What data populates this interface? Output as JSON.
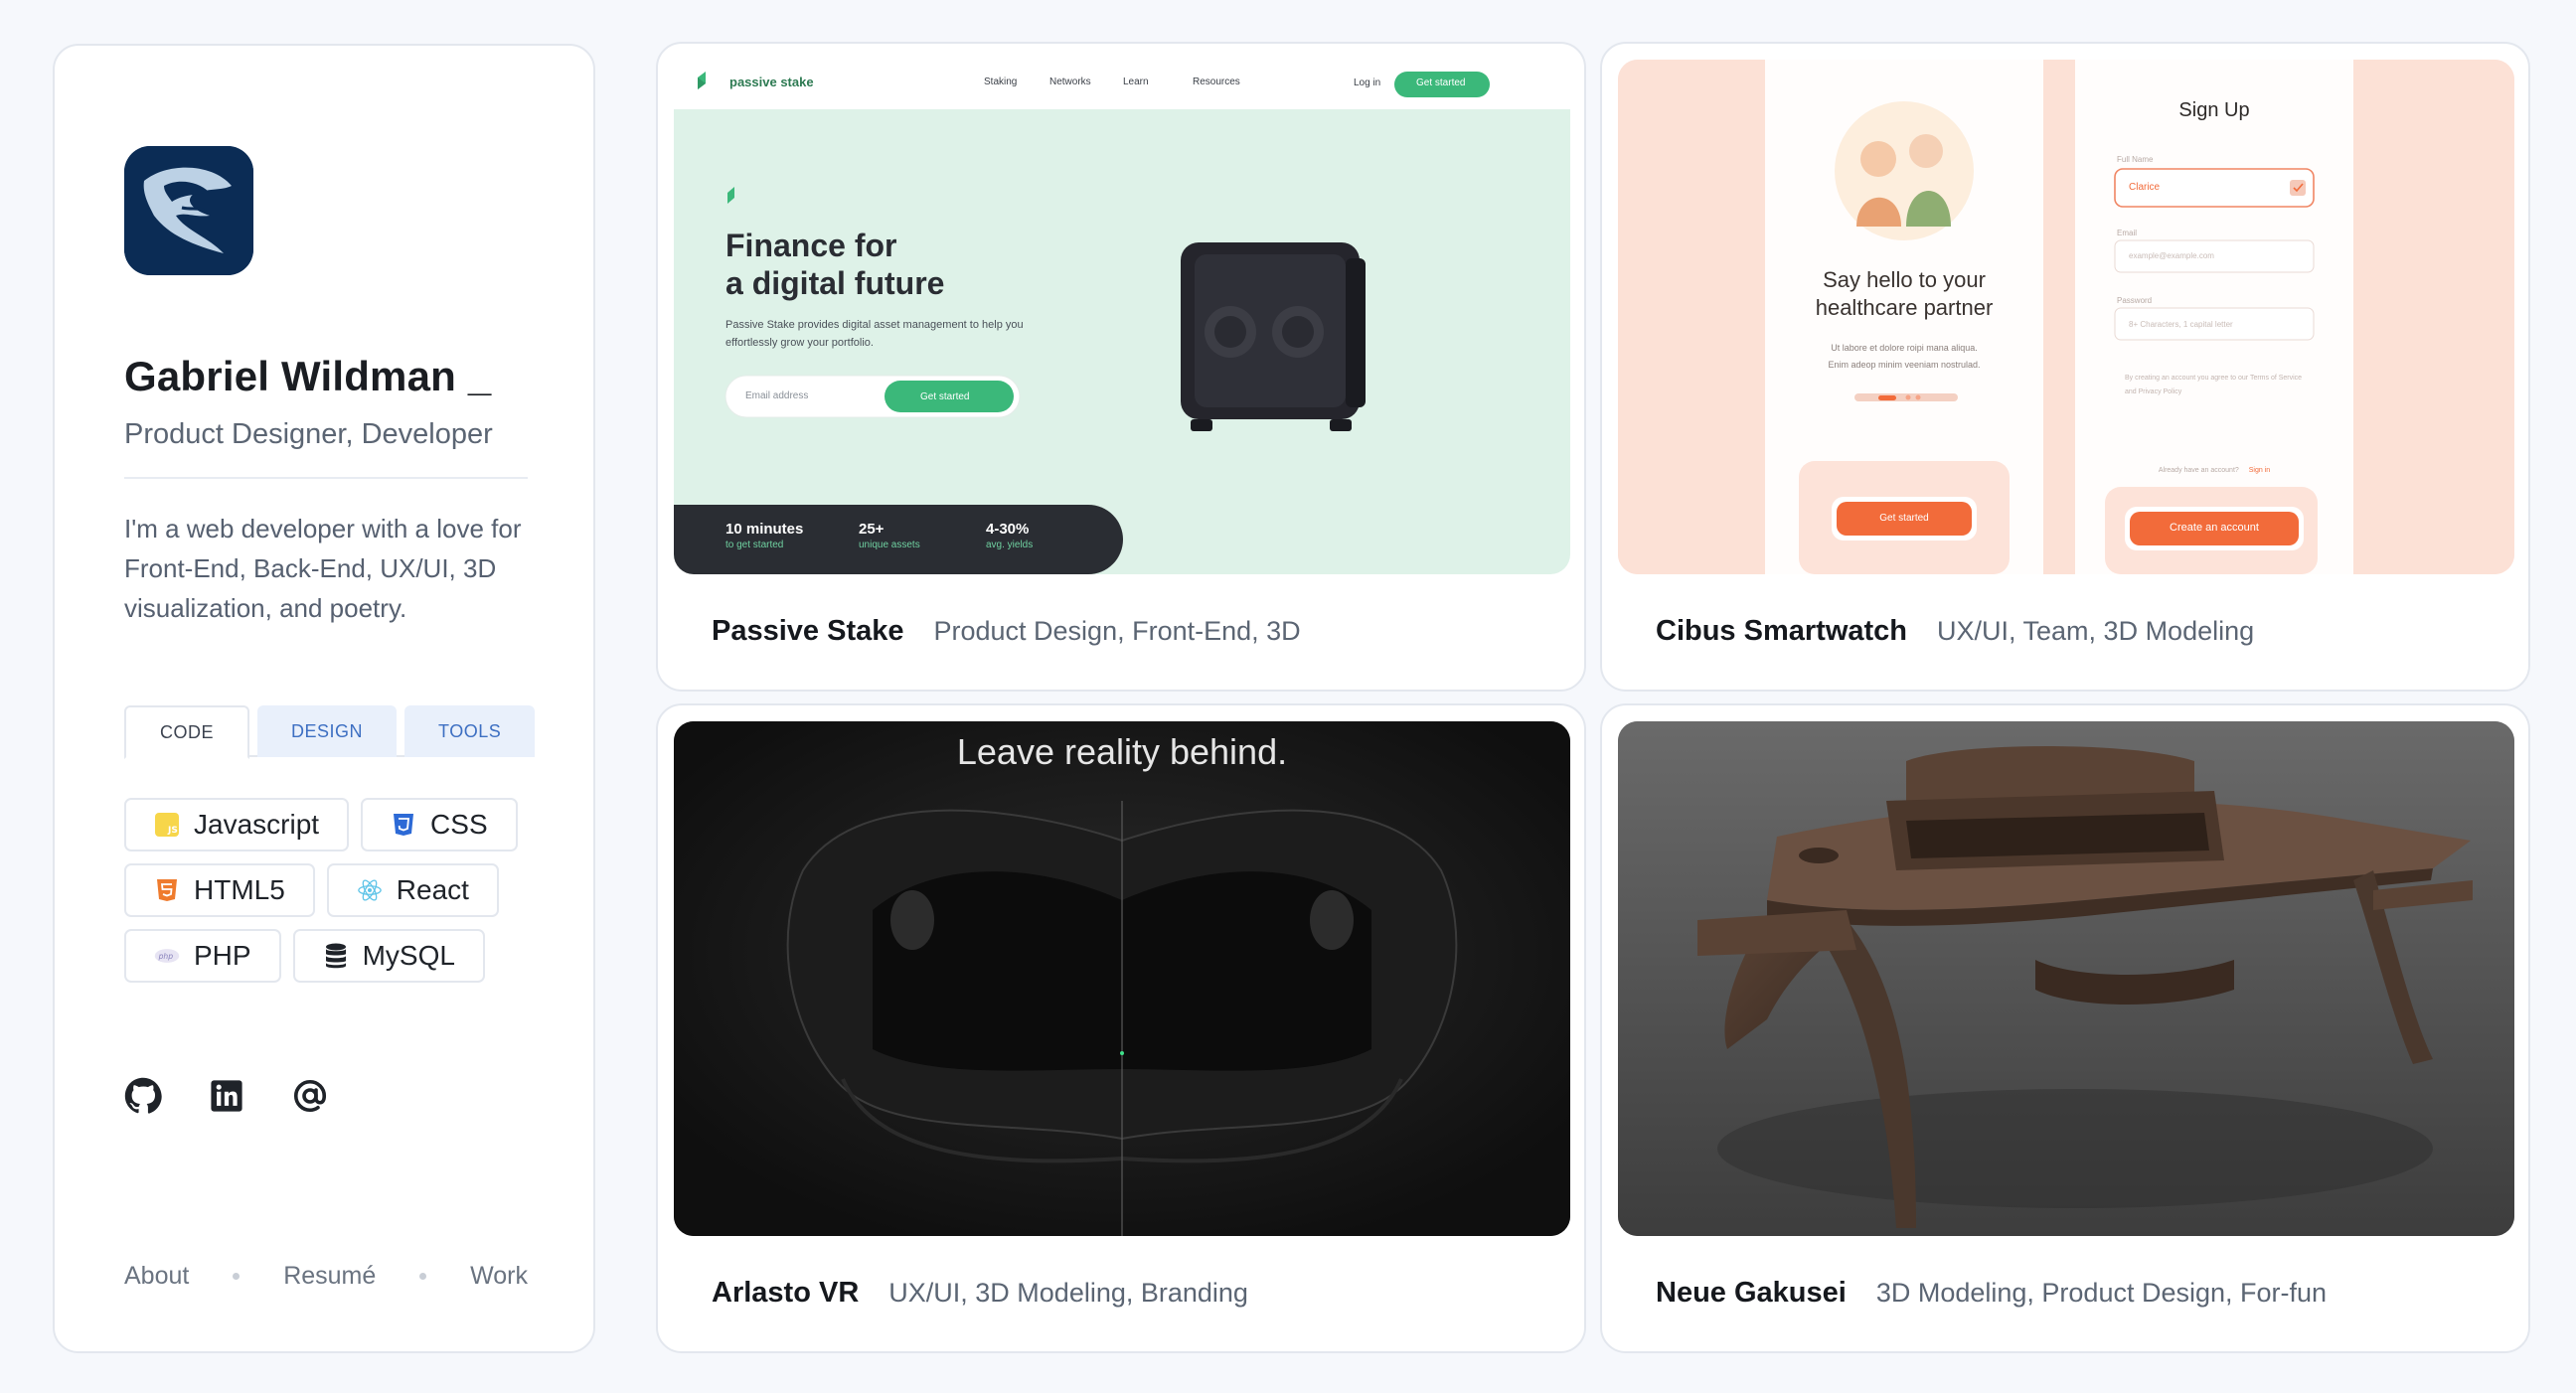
{
  "profile": {
    "name": "Gabriel Wildman _",
    "role": "Product Designer, Developer",
    "bio": "I'm a web developer with a love for Front-End, Back-End, UX/UI, 3D visualization, and poetry.",
    "tabs": [
      "CODE",
      "DESIGN",
      "TOOLS"
    ],
    "chips": [
      {
        "label": "Javascript",
        "icon": "javascript-icon"
      },
      {
        "label": "CSS",
        "icon": "css-icon"
      },
      {
        "label": "HTML5",
        "icon": "html5-icon"
      },
      {
        "label": "React",
        "icon": "react-icon"
      },
      {
        "label": "PHP",
        "icon": "php-icon"
      },
      {
        "label": "MySQL",
        "icon": "database-icon"
      }
    ],
    "socials": [
      "github-icon",
      "linkedin-icon",
      "at-sign-icon"
    ],
    "nav": [
      "About",
      "Resumé",
      "Work"
    ]
  },
  "projects": [
    {
      "title": "Passive Stake",
      "tags": "Product Design, Front-End, 3D"
    },
    {
      "title": "Cibus Smartwatch",
      "tags": "UX/UI, Team, 3D Modeling"
    },
    {
      "title": "Arlasto VR",
      "tags": "UX/UI, 3D Modeling, Branding"
    },
    {
      "title": "Neue Gakusei",
      "tags": "3D Modeling, Product Design, For-fun"
    }
  ],
  "passive_stake": {
    "logo": "passive stake",
    "nav": [
      "Staking",
      "Networks",
      "Learn",
      "Resources"
    ],
    "login": "Log in",
    "cta": "Get started",
    "headline_1": "Finance for",
    "headline_2": "a digital future",
    "sub": "Passive Stake provides digital asset management to help you effortlessly grow your portfolio.",
    "email_placeholder": "Email address",
    "form_cta": "Get started",
    "stats": [
      {
        "value": "10 minutes",
        "label": "to get started"
      },
      {
        "value": "25+",
        "label": "unique assets"
      },
      {
        "value": "4-30%",
        "label": "avg. yields"
      }
    ]
  },
  "cibus": {
    "hello_1": "Say hello to your",
    "hello_2": "healthcare partner",
    "small_1": "Ut labore et dolore roipi mana aliqua.",
    "small_2": "Enim adeop minim veeniam nostrulad.",
    "get_started": "Get started",
    "signup_title": "Sign Up",
    "full_name_label": "Full Name",
    "full_name_value": "Clarice",
    "email_label": "Email",
    "email_placeholder": "example@example.com",
    "password_label": "Password",
    "password_placeholder": "8+ Characters, 1 capital letter",
    "terms": "By creating an account you agree to our Terms of Service and Privacy Policy",
    "already": "Already have an account?",
    "signin": "Sign in",
    "create": "Create an account"
  },
  "vr": {
    "headline": "Leave reality behind."
  },
  "colors": {
    "accent_blue": "#3d6fc2",
    "stake_green": "#3bb87a",
    "cibus_orange": "#f26b3a"
  }
}
